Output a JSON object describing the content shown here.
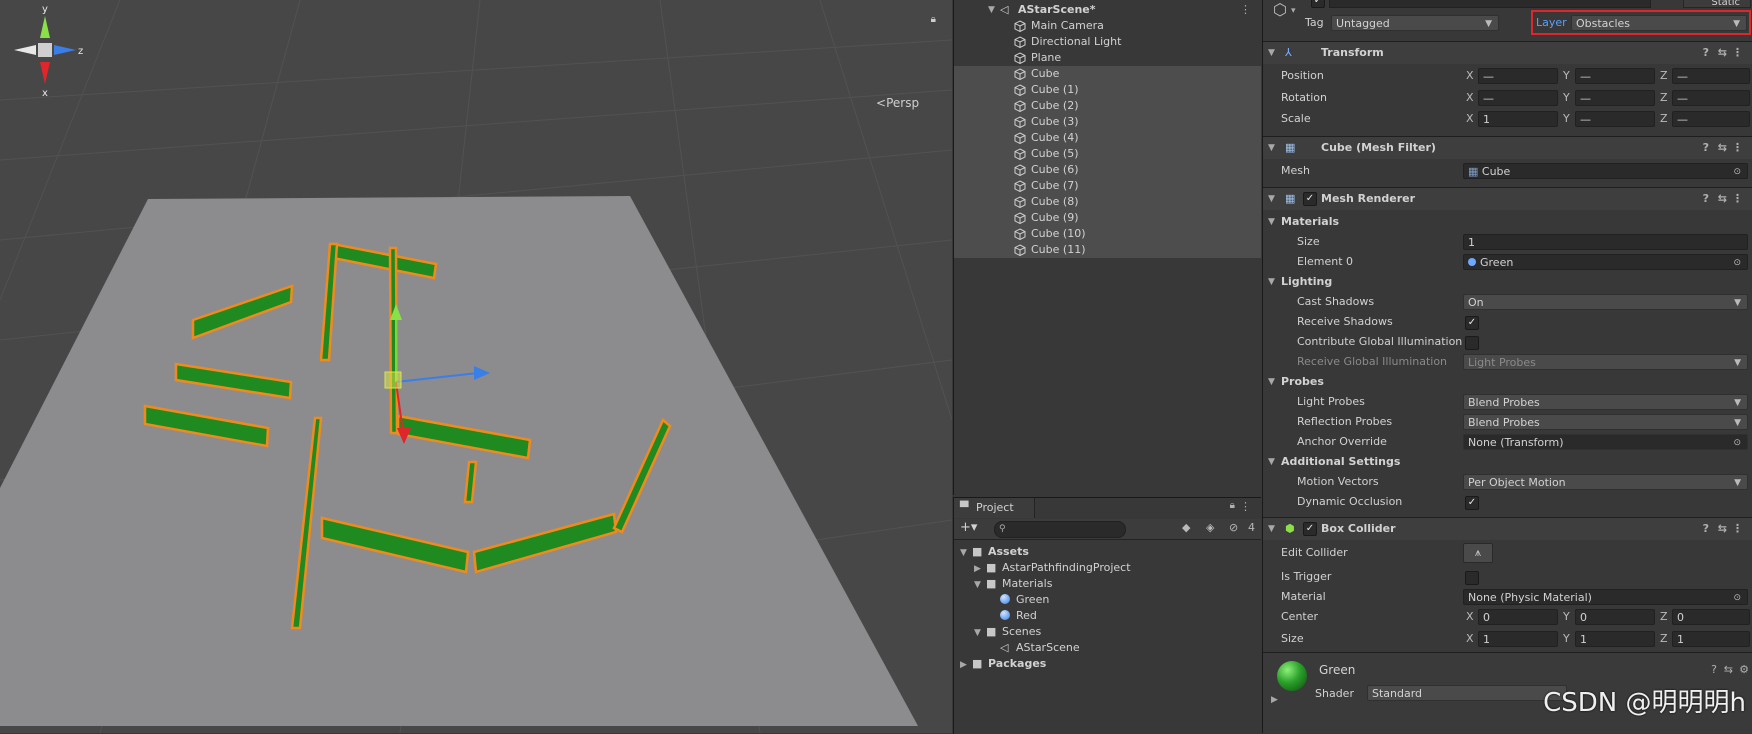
{
  "scene_view": {
    "persp_label": "Persp",
    "gizmo_axes": {
      "y": "y",
      "z": "z",
      "x": "x"
    }
  },
  "hierarchy": {
    "scene_name": "AStarScene*",
    "items": [
      {
        "label": "Main Camera",
        "selected": false
      },
      {
        "label": "Directional Light",
        "selected": false
      },
      {
        "label": "Plane",
        "selected": false
      },
      {
        "label": "Cube",
        "selected": true
      },
      {
        "label": "Cube (1)",
        "selected": true
      },
      {
        "label": "Cube (2)",
        "selected": true
      },
      {
        "label": "Cube (3)",
        "selected": true
      },
      {
        "label": "Cube (4)",
        "selected": true
      },
      {
        "label": "Cube (5)",
        "selected": true
      },
      {
        "label": "Cube (6)",
        "selected": true
      },
      {
        "label": "Cube (7)",
        "selected": true
      },
      {
        "label": "Cube (8)",
        "selected": true
      },
      {
        "label": "Cube (9)",
        "selected": true
      },
      {
        "label": "Cube (10)",
        "selected": true
      },
      {
        "label": "Cube (11)",
        "selected": true
      }
    ]
  },
  "project": {
    "tab_label": "Project",
    "hidden_count": "4",
    "tree": [
      {
        "label": "Assets",
        "depth": 0,
        "kind": "folder",
        "expanded": true
      },
      {
        "label": "AstarPathfindingProject",
        "depth": 1,
        "kind": "folder",
        "expanded": false
      },
      {
        "label": "Materials",
        "depth": 1,
        "kind": "folder",
        "expanded": true
      },
      {
        "label": "Green",
        "depth": 2,
        "kind": "material"
      },
      {
        "label": "Red",
        "depth": 2,
        "kind": "material"
      },
      {
        "label": "Scenes",
        "depth": 1,
        "kind": "folder",
        "expanded": true
      },
      {
        "label": "AStarScene",
        "depth": 2,
        "kind": "scene"
      },
      {
        "label": "Packages",
        "depth": 0,
        "kind": "folder",
        "expanded": false
      }
    ]
  },
  "inspector": {
    "static_label": "Static",
    "tag_label": "Tag",
    "tag_value": "Untagged",
    "layer_label": "Layer",
    "layer_value": "Obstacles",
    "transform": {
      "title": "Transform",
      "position": {
        "label": "Position",
        "x": "—",
        "y": "—",
        "z": "—"
      },
      "rotation": {
        "label": "Rotation",
        "x": "—",
        "y": "—",
        "z": "—"
      },
      "scale": {
        "label": "Scale",
        "x": "1",
        "y": "—",
        "z": "—"
      }
    },
    "mesh_filter": {
      "title": "Cube (Mesh Filter)",
      "mesh_label": "Mesh",
      "mesh_value": "Cube"
    },
    "mesh_renderer": {
      "title": "Mesh Renderer",
      "materials": "Materials",
      "size_label": "Size",
      "size_value": "1",
      "element0_label": "Element 0",
      "element0_value": "Green",
      "lighting": "Lighting",
      "cast_shadows_label": "Cast Shadows",
      "cast_shadows_value": "On",
      "receive_shadows_label": "Receive Shadows",
      "contribute_gi_label": "Contribute Global Illumination",
      "receive_gi_label": "Receive Global Illumination",
      "receive_gi_value": "Light Probes",
      "probes": "Probes",
      "light_probes_label": "Light Probes",
      "light_probes_value": "Blend Probes",
      "reflection_probes_label": "Reflection Probes",
      "reflection_probes_value": "Blend Probes",
      "anchor_override_label": "Anchor Override",
      "anchor_override_value": "None (Transform)",
      "additional": "Additional Settings",
      "motion_vectors_label": "Motion Vectors",
      "motion_vectors_value": "Per Object Motion",
      "dynamic_occlusion_label": "Dynamic Occlusion"
    },
    "box_collider": {
      "title": "Box Collider",
      "edit_collider_label": "Edit Collider",
      "is_trigger_label": "Is Trigger",
      "material_label": "Material",
      "material_value": "None (Physic Material)",
      "center_label": "Center",
      "center": {
        "x": "0",
        "y": "0",
        "z": "0"
      },
      "size_label": "Size",
      "size": {
        "x": "1",
        "y": "1",
        "z": "1"
      }
    },
    "material": {
      "name": "Green",
      "shader_label": "Shader",
      "shader_value": "Standard"
    }
  },
  "watermark": "CSDN @明明明h",
  "colors": {
    "accent": "#2b7bd6",
    "obstacle_green": "#1f8a1f",
    "outline_orange": "#f08a1c",
    "highlight_red": "#e0262a"
  }
}
